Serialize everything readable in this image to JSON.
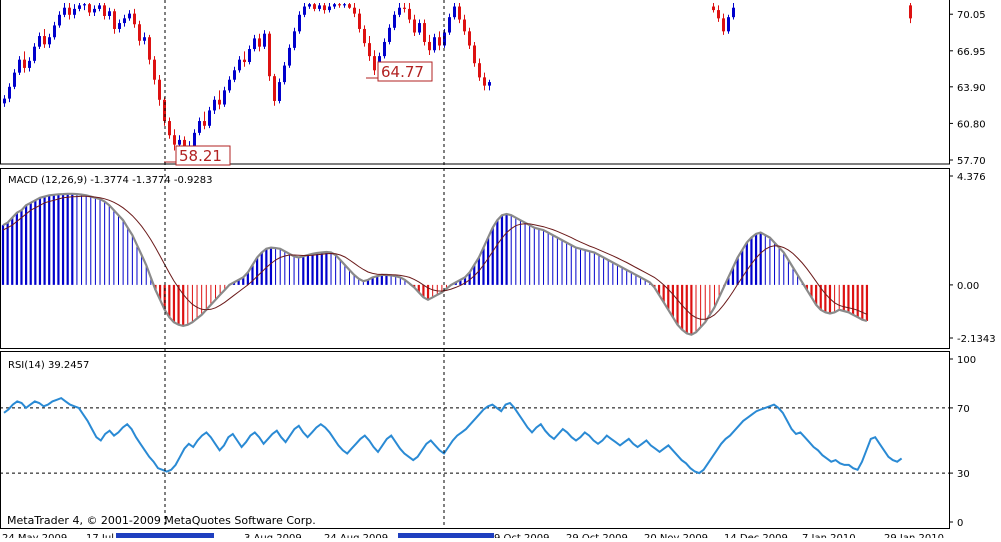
{
  "app": {
    "copyright": "MetaTrader 4, © 2001-2009 MetaQuotes Software Corp."
  },
  "colors": {
    "bull": "#0000cc",
    "bear": "#dd1111",
    "macd_line": "#8a8a8a",
    "signal_line": "#6b1a1a",
    "rsi_line": "#2a8ad4",
    "grid": "#000000",
    "label_red": "#b22222"
  },
  "price_panel": {
    "axis_ticks": [
      "70.05",
      "66.95",
      "63.90",
      "60.80",
      "57.70"
    ],
    "ylim": [
      57.7,
      71.0
    ],
    "annotations": [
      {
        "text": "58.21",
        "value": 58.21
      },
      {
        "text": "64.77",
        "value": 64.77
      }
    ]
  },
  "macd_panel": {
    "label": "MACD (12,26,9) -1.3774 -1.3774 -0.9283",
    "axis_ticks": [
      "4.376",
      "0.00",
      "-2.1343"
    ],
    "ylim": [
      -2.1343,
      4.376
    ]
  },
  "rsi_panel": {
    "label": "RSI(14) 39.2457",
    "axis_ticks": [
      "100",
      "70",
      "30",
      "0"
    ],
    "levels": [
      70,
      30
    ],
    "ylim": [
      0,
      100
    ]
  },
  "time_axis": {
    "labels": [
      "24 May 2009",
      "17 Jul",
      "",
      "3 Aug 2009",
      "24 Aug 2009",
      "",
      "9 Oct 2009",
      "29 Oct 2009",
      "20 Nov 2009",
      "14 Dec 2009",
      "7 Jan 2010",
      "29 Jan 2010"
    ]
  },
  "chart_data": {
    "type": "candlestick+macd+rsi",
    "price": {
      "candles": [
        [
          62.5,
          63.2,
          62.2,
          62.9
        ],
        [
          62.9,
          64.2,
          62.6,
          63.9
        ],
        [
          63.9,
          65.4,
          63.7,
          65.1
        ],
        [
          65.1,
          66.5,
          64.9,
          66.2
        ],
        [
          66.2,
          66.9,
          65.1,
          65.5
        ],
        [
          65.5,
          66.4,
          65.2,
          66.1
        ],
        [
          66.1,
          67.6,
          65.9,
          67.3
        ],
        [
          67.3,
          68.5,
          67.1,
          68.2
        ],
        [
          68.2,
          68.8,
          67.2,
          67.5
        ],
        [
          67.5,
          68.4,
          67.2,
          68.1
        ],
        [
          68.1,
          69.4,
          67.9,
          69.1
        ],
        [
          69.1,
          70.3,
          68.9,
          70.0
        ],
        [
          70.0,
          71.0,
          69.8,
          70.6
        ],
        [
          70.6,
          71.0,
          69.6,
          70.0
        ],
        [
          70.0,
          70.9,
          69.7,
          70.5
        ],
        [
          70.5,
          71.0,
          70.3,
          70.8
        ],
        [
          70.8,
          71.0,
          70.4,
          70.9
        ],
        [
          70.9,
          71.0,
          69.9,
          70.2
        ],
        [
          70.2,
          70.8,
          69.9,
          70.5
        ],
        [
          70.5,
          71.0,
          70.3,
          70.8
        ],
        [
          70.8,
          71.0,
          69.6,
          69.9
        ],
        [
          69.9,
          70.6,
          69.6,
          70.3
        ],
        [
          70.3,
          70.5,
          68.4,
          68.8
        ],
        [
          68.8,
          69.6,
          68.5,
          69.3
        ],
        [
          69.3,
          70.0,
          69.0,
          69.7
        ],
        [
          69.7,
          70.4,
          69.5,
          70.1
        ],
        [
          70.1,
          70.5,
          68.9,
          69.2
        ],
        [
          69.2,
          69.5,
          67.4,
          67.8
        ],
        [
          67.8,
          68.5,
          67.5,
          68.1
        ],
        [
          68.1,
          68.3,
          65.8,
          66.2
        ],
        [
          66.2,
          66.5,
          64.1,
          64.5
        ],
        [
          64.5,
          64.9,
          62.3,
          62.8
        ],
        [
          62.8,
          63.0,
          60.6,
          61.0
        ],
        [
          61.0,
          61.3,
          59.5,
          59.8
        ],
        [
          59.8,
          60.3,
          58.5,
          59.0
        ],
        [
          59.0,
          59.8,
          58.2,
          59.4
        ],
        [
          59.4,
          59.7,
          58.0,
          58.4
        ],
        [
          58.4,
          59.3,
          58.1,
          58.9
        ],
        [
          58.9,
          60.3,
          58.6,
          60.0
        ],
        [
          60.0,
          61.3,
          59.8,
          61.0
        ],
        [
          61.0,
          61.8,
          60.3,
          60.6
        ],
        [
          60.6,
          62.2,
          60.4,
          61.9
        ],
        [
          61.9,
          63.1,
          61.6,
          62.8
        ],
        [
          62.8,
          63.6,
          62.0,
          62.4
        ],
        [
          62.4,
          63.9,
          62.2,
          63.6
        ],
        [
          63.6,
          64.8,
          63.4,
          64.5
        ],
        [
          64.5,
          65.6,
          64.3,
          65.3
        ],
        [
          65.3,
          66.5,
          65.1,
          66.2
        ],
        [
          66.2,
          66.9,
          65.6,
          66.0
        ],
        [
          66.0,
          67.4,
          65.8,
          67.1
        ],
        [
          67.1,
          68.3,
          66.9,
          68.0
        ],
        [
          68.0,
          68.4,
          66.9,
          67.3
        ],
        [
          67.3,
          68.7,
          67.1,
          68.4
        ],
        [
          68.4,
          68.6,
          64.4,
          64.8
        ],
        [
          64.8,
          65.0,
          62.3,
          62.7
        ],
        [
          62.7,
          64.6,
          62.5,
          64.3
        ],
        [
          64.3,
          66.0,
          64.1,
          65.7
        ],
        [
          65.7,
          67.5,
          65.5,
          67.2
        ],
        [
          67.2,
          68.9,
          67.0,
          68.6
        ],
        [
          68.6,
          70.3,
          68.4,
          70.0
        ],
        [
          70.0,
          71.0,
          69.8,
          70.7
        ],
        [
          70.7,
          71.0,
          70.5,
          70.9
        ],
        [
          70.9,
          71.0,
          70.3,
          70.5
        ],
        [
          70.5,
          71.0,
          70.3,
          70.8
        ],
        [
          70.8,
          71.0,
          70.1,
          70.4
        ],
        [
          70.4,
          71.0,
          70.2,
          70.7
        ],
        [
          70.7,
          71.0,
          70.5,
          70.9
        ],
        [
          70.9,
          71.0,
          70.6,
          70.8
        ],
        [
          70.8,
          71.0,
          70.6,
          70.9
        ],
        [
          70.9,
          71.0,
          70.5,
          70.6
        ],
        [
          70.6,
          71.0,
          69.8,
          70.1
        ],
        [
          70.1,
          70.5,
          68.5,
          68.8
        ],
        [
          68.8,
          69.1,
          67.3,
          67.6
        ],
        [
          67.6,
          68.2,
          66.1,
          66.5
        ],
        [
          66.5,
          67.0,
          64.9,
          65.3
        ],
        [
          65.3,
          66.8,
          65.1,
          66.5
        ],
        [
          66.5,
          68.0,
          66.3,
          67.7
        ],
        [
          67.7,
          69.2,
          67.5,
          68.9
        ],
        [
          68.9,
          70.3,
          68.7,
          70.0
        ],
        [
          70.0,
          71.0,
          69.8,
          70.6
        ],
        [
          70.6,
          71.0,
          70.2,
          70.5
        ],
        [
          70.5,
          71.0,
          69.3,
          69.6
        ],
        [
          69.6,
          70.0,
          68.2,
          68.5
        ],
        [
          68.5,
          69.6,
          68.3,
          69.3
        ],
        [
          69.3,
          69.6,
          67.4,
          67.7
        ],
        [
          67.7,
          68.3,
          66.6,
          67.0
        ],
        [
          67.0,
          68.4,
          66.8,
          68.1
        ],
        [
          68.1,
          68.6,
          67.0,
          67.4
        ],
        [
          67.4,
          68.8,
          67.2,
          68.5
        ],
        [
          68.5,
          70.1,
          68.3,
          69.8
        ],
        [
          69.8,
          71.0,
          69.6,
          70.7
        ],
        [
          70.7,
          71.0,
          69.3,
          69.6
        ],
        [
          69.6,
          70.0,
          68.3,
          68.6
        ],
        [
          68.6,
          68.9,
          67.1,
          67.4
        ],
        [
          67.4,
          67.7,
          65.6,
          65.9
        ],
        [
          65.9,
          66.3,
          64.4,
          64.7
        ],
        [
          64.7,
          65.1,
          63.6,
          64.0
        ],
        [
          64.0,
          64.5,
          63.6,
          64.3
        ]
      ],
      "gap_candles": [
        [
          70.7,
          71.0,
          70.2,
          70.4
        ],
        [
          70.4,
          70.8,
          69.4,
          69.7
        ],
        [
          69.7,
          70.1,
          68.3,
          68.6
        ],
        [
          68.6,
          70.0,
          68.4,
          69.8
        ],
        [
          69.8,
          71.0,
          69.6,
          70.6
        ]
      ],
      "late_candles": [
        [
          70.8,
          71.0,
          69.3,
          69.7
        ]
      ]
    },
    "macd": {
      "histogram": [
        2.4,
        2.5,
        2.7,
        2.9,
        3.0,
        3.2,
        3.3,
        3.4,
        3.5,
        3.55,
        3.6,
        3.62,
        3.64,
        3.65,
        3.66,
        3.66,
        3.65,
        3.63,
        3.6,
        3.55,
        3.5,
        3.45,
        3.35,
        3.2,
        3.0,
        2.8,
        2.6,
        2.3,
        2.0,
        1.6,
        1.2,
        0.8,
        0.3,
        -0.2,
        -0.6,
        -1.0,
        -1.3,
        -1.5,
        -1.6,
        -1.65,
        -1.6,
        -1.5,
        -1.35,
        -1.2,
        -1.0,
        -0.8,
        -0.6,
        -0.4,
        -0.2,
        0.0,
        0.1,
        0.2,
        0.3,
        0.5,
        0.8,
        1.1,
        1.3,
        1.45,
        1.5,
        1.48,
        1.45,
        1.35,
        1.25,
        1.15,
        1.1,
        1.15,
        1.2,
        1.25,
        1.28,
        1.3,
        1.32,
        1.3,
        1.2,
        1.0,
        0.8,
        0.6,
        0.4,
        0.25,
        0.15,
        0.2,
        0.3,
        0.35,
        0.4,
        0.4,
        0.38,
        0.35,
        0.3,
        0.2,
        0.05,
        -0.1,
        -0.3,
        -0.5,
        -0.6,
        -0.5,
        -0.4,
        -0.3,
        -0.15,
        0.0,
        0.1,
        0.2,
        0.3,
        0.5,
        0.8,
        1.1,
        1.5,
        1.9,
        2.3,
        2.6,
        2.8,
        2.85,
        2.8,
        2.7,
        2.6,
        2.5,
        2.4,
        2.3,
        2.25,
        2.2,
        2.1,
        2.0,
        1.9,
        1.8,
        1.7,
        1.6,
        1.5,
        1.45,
        1.4,
        1.35,
        1.3,
        1.2,
        1.1,
        1.0,
        0.9,
        0.8,
        0.7,
        0.6,
        0.5,
        0.4,
        0.3,
        0.2,
        0.1,
        -0.1,
        -0.4,
        -0.7,
        -1.0,
        -1.3,
        -1.6,
        -1.8,
        -1.95,
        -2.0,
        -1.9,
        -1.7,
        -1.5,
        -1.2,
        -0.9,
        -0.5,
        -0.1,
        0.3,
        0.7,
        1.1,
        1.4,
        1.7,
        1.9,
        2.05,
        2.1,
        2.0,
        1.9,
        1.7,
        1.5,
        1.3,
        1.0,
        0.7,
        0.4,
        0.1,
        -0.2,
        -0.5,
        -0.8,
        -1.0,
        -1.1,
        -1.15,
        -1.1,
        -1.0,
        -1.05,
        -1.1,
        -1.2,
        -1.3,
        -1.4,
        -1.45
      ],
      "signal": [
        2.2,
        2.3,
        2.4,
        2.55,
        2.7,
        2.85,
        3.0,
        3.1,
        3.2,
        3.3,
        3.35,
        3.4,
        3.45,
        3.5,
        3.52,
        3.54,
        3.55,
        3.56,
        3.56,
        3.55,
        3.53,
        3.5,
        3.46,
        3.4,
        3.32,
        3.22,
        3.1,
        2.95,
        2.78,
        2.58,
        2.36,
        2.1,
        1.82,
        1.5,
        1.16,
        0.82,
        0.48,
        0.16,
        -0.12,
        -0.38,
        -0.6,
        -0.78,
        -0.9,
        -0.98,
        -1.0,
        -0.98,
        -0.92,
        -0.82,
        -0.7,
        -0.56,
        -0.42,
        -0.28,
        -0.14,
        0.0,
        0.16,
        0.34,
        0.52,
        0.7,
        0.86,
        1.0,
        1.1,
        1.16,
        1.2,
        1.2,
        1.19,
        1.18,
        1.18,
        1.19,
        1.21,
        1.23,
        1.25,
        1.26,
        1.25,
        1.2,
        1.12,
        1.0,
        0.87,
        0.74,
        0.62,
        0.52,
        0.46,
        0.43,
        0.42,
        0.41,
        0.41,
        0.4,
        0.38,
        0.35,
        0.3,
        0.22,
        0.12,
        0.0,
        -0.12,
        -0.2,
        -0.24,
        -0.25,
        -0.22,
        -0.17,
        -0.1,
        -0.02,
        0.08,
        0.2,
        0.36,
        0.56,
        0.8,
        1.06,
        1.34,
        1.62,
        1.88,
        2.1,
        2.26,
        2.38,
        2.44,
        2.46,
        2.45,
        2.42,
        2.38,
        2.34,
        2.28,
        2.22,
        2.15,
        2.07,
        1.99,
        1.9,
        1.81,
        1.72,
        1.64,
        1.56,
        1.49,
        1.41,
        1.33,
        1.25,
        1.17,
        1.08,
        0.99,
        0.9,
        0.8,
        0.7,
        0.6,
        0.5,
        0.4,
        0.3,
        0.16,
        0.0,
        -0.18,
        -0.38,
        -0.6,
        -0.82,
        -1.02,
        -1.2,
        -1.32,
        -1.38,
        -1.38,
        -1.32,
        -1.2,
        -1.02,
        -0.8,
        -0.55,
        -0.27,
        0.02,
        0.3,
        0.58,
        0.84,
        1.08,
        1.28,
        1.43,
        1.53,
        1.57,
        1.56,
        1.5,
        1.4,
        1.26,
        1.08,
        0.88,
        0.65,
        0.4,
        0.14,
        -0.12,
        -0.36,
        -0.56,
        -0.72,
        -0.82,
        -0.88,
        -0.92,
        -0.96,
        -1.02,
        -1.1,
        -1.18
      ]
    },
    "rsi": [
      67,
      69,
      72,
      74,
      73,
      70,
      72,
      74,
      73,
      71,
      72,
      74,
      75,
      76,
      74,
      72,
      71,
      70,
      66,
      62,
      57,
      52,
      50,
      54,
      56,
      53,
      55,
      58,
      60,
      57,
      52,
      48,
      44,
      40,
      37,
      33,
      32,
      31,
      32,
      35,
      40,
      45,
      48,
      46,
      50,
      53,
      55,
      52,
      48,
      44,
      47,
      52,
      54,
      50,
      46,
      49,
      53,
      55,
      52,
      48,
      51,
      54,
      56,
      52,
      49,
      53,
      57,
      59,
      55,
      52,
      55,
      58,
      60,
      58,
      55,
      51,
      47,
      44,
      42,
      45,
      48,
      51,
      53,
      50,
      46,
      43,
      47,
      51,
      53,
      49,
      45,
      42,
      40,
      38,
      40,
      44,
      48,
      50,
      47,
      44,
      42,
      46,
      50,
      53,
      55,
      57,
      60,
      63,
      66,
      69,
      71,
      72,
      70,
      68,
      72,
      73,
      70,
      66,
      62,
      58,
      55,
      58,
      60,
      56,
      53,
      51,
      54,
      57,
      55,
      52,
      50,
      52,
      55,
      53,
      50,
      48,
      50,
      53,
      51,
      49,
      47,
      49,
      51,
      48,
      46,
      48,
      50,
      47,
      45,
      43,
      45,
      47,
      44,
      41,
      38,
      36,
      33,
      31,
      30,
      32,
      36,
      40,
      44,
      48,
      51,
      53,
      56,
      59,
      62,
      64,
      66,
      68,
      69,
      70,
      71,
      72,
      70,
      67,
      62,
      57,
      54,
      55,
      52,
      49,
      46,
      44,
      41,
      39,
      37,
      38,
      36,
      35,
      35,
      33,
      32,
      37,
      44,
      51,
      52,
      48,
      44,
      40,
      38,
      37,
      39
    ],
    "markers": [
      58.21,
      64.77
    ]
  }
}
